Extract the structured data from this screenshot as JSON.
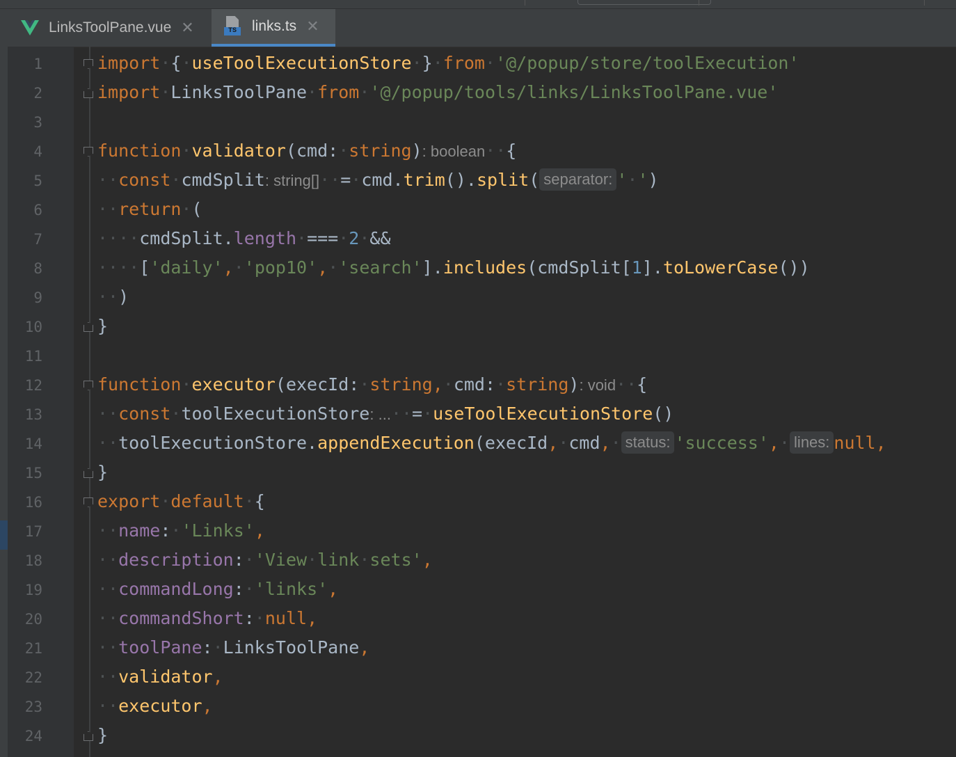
{
  "tabs": [
    {
      "label": "LinksToolPane.vue",
      "icon": "vue-file-icon",
      "active": false
    },
    {
      "label": "links.ts",
      "icon": "typescript-file-icon",
      "active": true
    }
  ],
  "close_glyph": "✕",
  "editor": {
    "line_numbers": [
      "1",
      "2",
      "3",
      "4",
      "5",
      "6",
      "7",
      "8",
      "9",
      "10",
      "11",
      "12",
      "13",
      "14",
      "15",
      "16",
      "17",
      "18",
      "19",
      "20",
      "21",
      "22",
      "23",
      "24"
    ],
    "inlay_hints": {
      "validator_return": ": boolean",
      "cmdSplit_type": ": string[]",
      "separator_param": "separator:",
      "executor_return": ": void",
      "store_type": ": ...",
      "status_param": "status:",
      "lines_param": "lines:"
    }
  },
  "colors": {
    "keyword": "#cc7832",
    "string": "#6a8759",
    "function": "#ffc66d",
    "property": "#9876aa",
    "number": "#6897bb",
    "text": "#a9b7c6",
    "background": "#2b2b2b",
    "active_tab_underline": "#4a88c7"
  }
}
